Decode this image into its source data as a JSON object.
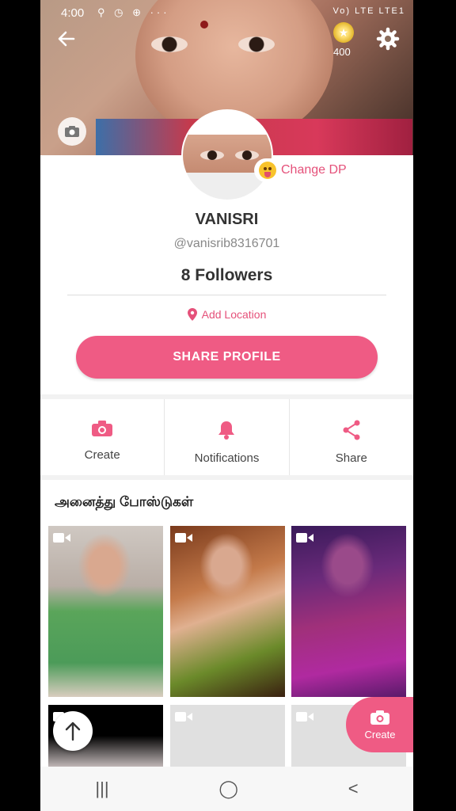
{
  "status_bar": {
    "time": "4:00",
    "signal_text": "Vo) LTE LTE1",
    "left_icons": "⚲ ◷ ⊕ ···"
  },
  "header": {
    "coins": "400",
    "change_dp_label": "Change DP"
  },
  "profile": {
    "name": "VANISRI",
    "handle": "@vanisrib8316701",
    "followers": "8 Followers",
    "add_location": "Add Location",
    "share_profile": "SHARE PROFILE"
  },
  "actions": [
    {
      "label": "Create",
      "icon": "camera-icon"
    },
    {
      "label": "Notifications",
      "icon": "bell-icon"
    },
    {
      "label": "Share",
      "icon": "share-icon"
    }
  ],
  "posts": {
    "title": "அனைத்து போஸ்டுகள்"
  },
  "fab": {
    "label": "Create"
  },
  "navbar": {
    "recents": "|||",
    "home": "◯",
    "back": "<"
  },
  "colors": {
    "accent": "#ef5b84",
    "accent_text": "#e5517a"
  }
}
